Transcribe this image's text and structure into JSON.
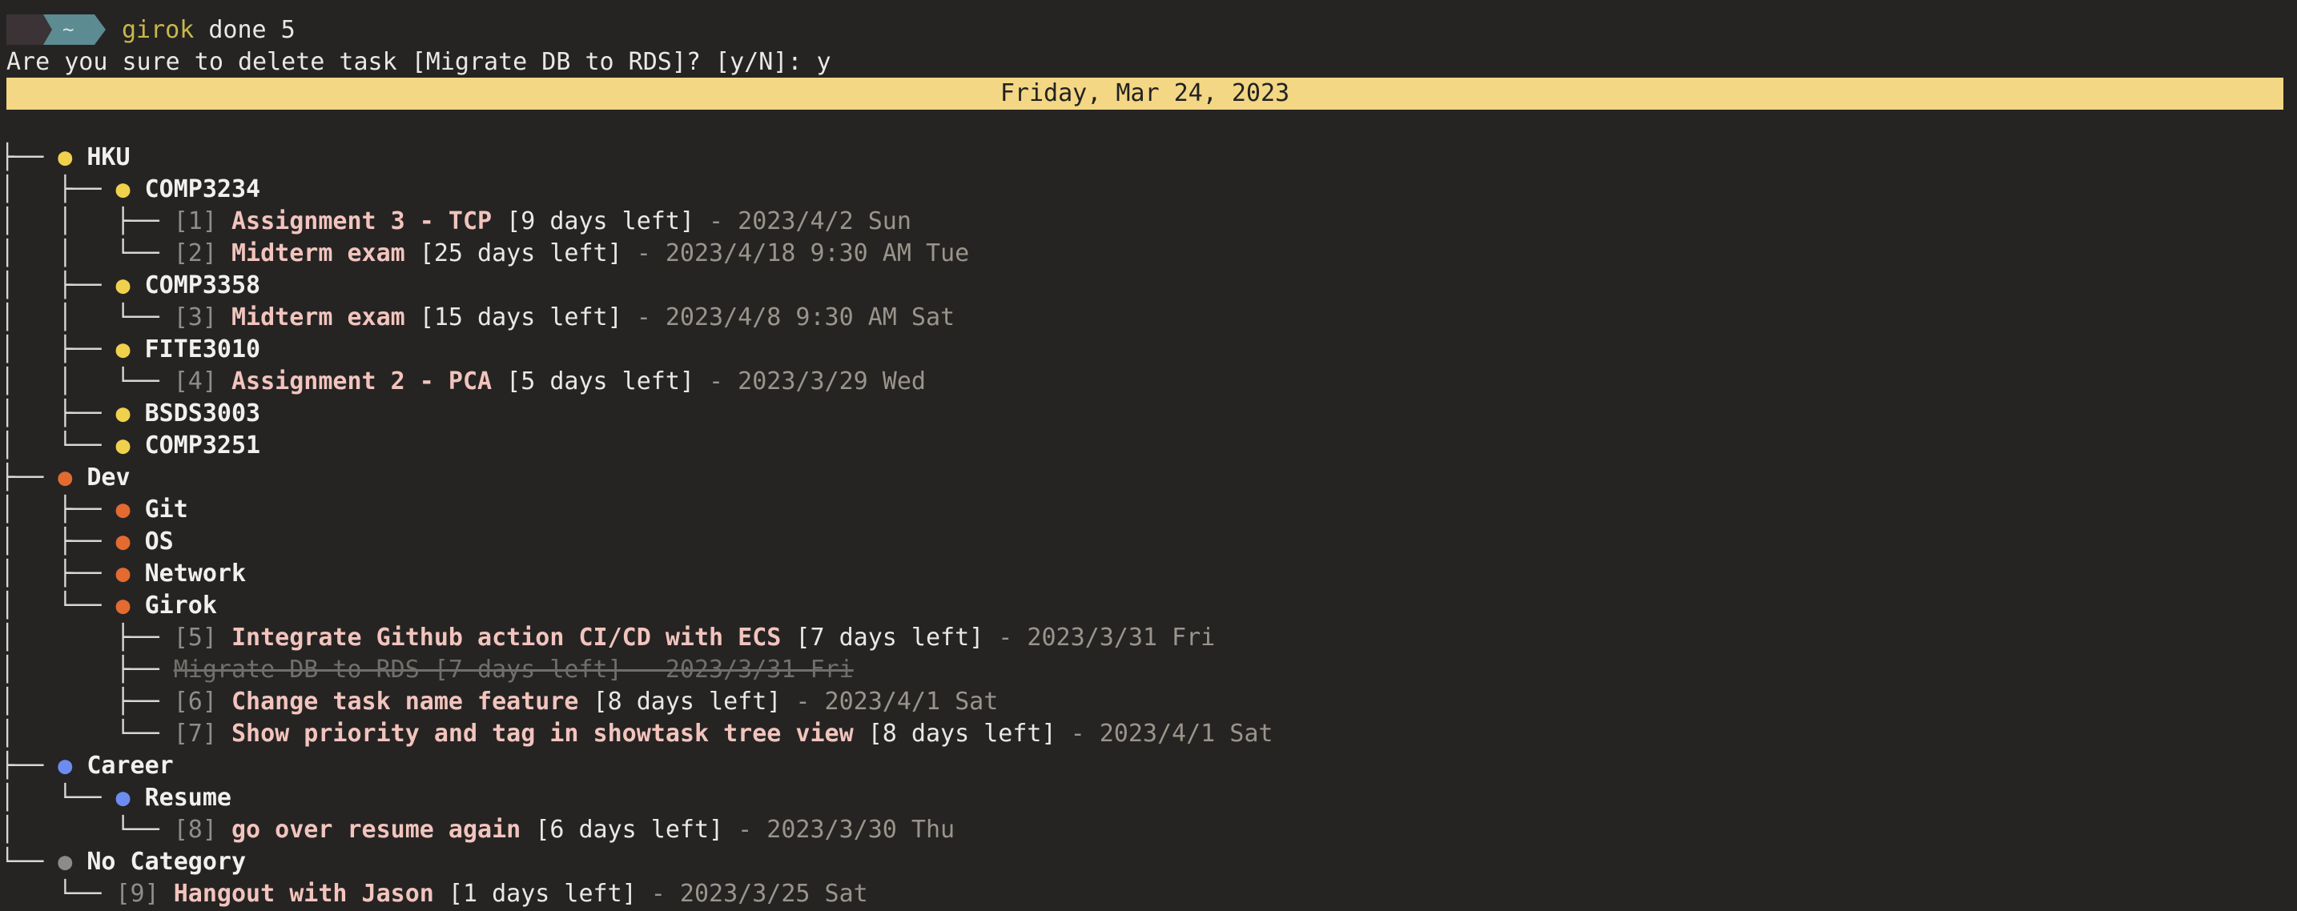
{
  "prompt": {
    "tilde": "~",
    "command": "girok",
    "args": "done 5"
  },
  "confirm": "Are you sure to delete task [Migrate DB to RDS]? [y/N]: y",
  "banner_date": "Friday, Mar 24, 2023",
  "colors": {
    "background": "#252423",
    "banner": "#f3d784",
    "task": "#f2c4bd",
    "bullet_hku": "#f0d14c",
    "bullet_dev": "#e36a30",
    "bullet_career": "#6d8cf2",
    "bullet_nocat": "#8b8b8b"
  },
  "tree": {
    "hku": "HKU",
    "comp3234": "COMP3234",
    "t1": {
      "idx": "[1]",
      "name": "Assignment 3 - TCP",
      "left": "[9 days left]",
      "date": "- 2023/4/2 Sun"
    },
    "t2": {
      "idx": "[2]",
      "name": "Midterm exam",
      "left": "[25 days left]",
      "date": "- 2023/4/18 9:30 AM Tue"
    },
    "comp3358": "COMP3358",
    "t3": {
      "idx": "[3]",
      "name": "Midterm exam",
      "left": "[15 days left]",
      "date": "- 2023/4/8 9:30 AM Sat"
    },
    "fite3010": "FITE3010",
    "t4": {
      "idx": "[4]",
      "name": "Assignment 2 - PCA",
      "left": "[5 days left]",
      "date": "- 2023/3/29 Wed"
    },
    "bsds3003": "BSDS3003",
    "comp3251": "COMP3251",
    "dev": "Dev",
    "git": "Git",
    "os": "OS",
    "network": "Network",
    "girok": "Girok",
    "t5": {
      "idx": "[5]",
      "name": "Integrate Github action CI/CD with ECS",
      "left": "[7 days left]",
      "date": "- 2023/3/31 Fri"
    },
    "done_task": "Migrate DB to RDS [7 days left] - 2023/3/31 Fri",
    "t6": {
      "idx": "[6]",
      "name": "Change task name feature",
      "left": "[8 days left]",
      "date": "- 2023/4/1 Sat"
    },
    "t7": {
      "idx": "[7]",
      "name": "Show priority and tag in showtask tree view",
      "left": "[8 days left]",
      "date": "- 2023/4/1 Sat"
    },
    "career": "Career",
    "resume": "Resume",
    "t8": {
      "idx": "[8]",
      "name": "go over resume again",
      "left": "[6 days left]",
      "date": "- 2023/3/30 Thu"
    },
    "nocat": "No Category",
    "t9": {
      "idx": "[9]",
      "name": "Hangout with Jason",
      "left": "[1 days left]",
      "date": "- 2023/3/25 Sat"
    }
  }
}
